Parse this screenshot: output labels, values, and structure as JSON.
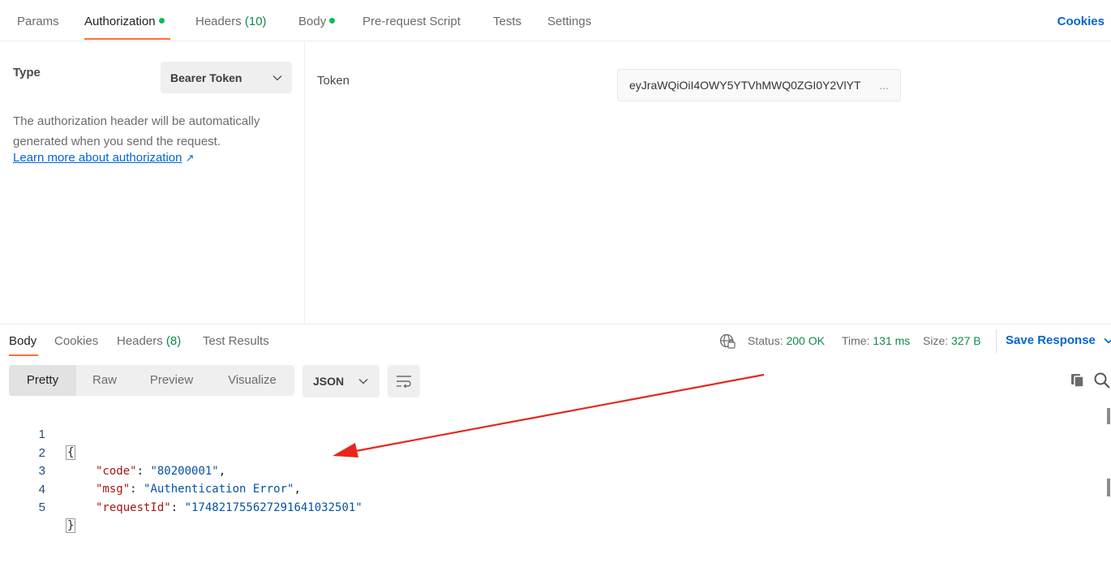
{
  "request_tabs": {
    "params": "Params",
    "authorization": "Authorization",
    "headers": "Headers",
    "headers_count": "(10)",
    "body": "Body",
    "pre_request": "Pre-request Script",
    "tests": "Tests",
    "settings": "Settings",
    "cookies": "Cookies"
  },
  "auth": {
    "type_label": "Type",
    "type_value": "Bearer Token",
    "description": "The authorization header will be automatically generated when you send the request.",
    "learn_more": "Learn more about authorization",
    "learn_more_arrow": "↗",
    "token_label": "Token",
    "token_value": "eyJraWQiOiI4OWY5YTVhMWQ0ZGI0Y2VlYT",
    "token_ellipsis": "..."
  },
  "response": {
    "tabs": {
      "body": "Body",
      "cookies": "Cookies",
      "headers": "Headers",
      "headers_count": "(8)",
      "test_results": "Test Results"
    },
    "status_label": "Status:",
    "status_value": "200 OK",
    "time_label": "Time:",
    "time_value": "131 ms",
    "size_label": "Size:",
    "size_value": "327 B",
    "save_response": "Save Response",
    "view_modes": [
      "Pretty",
      "Raw",
      "Preview",
      "Visualize"
    ],
    "format": "JSON"
  },
  "code": {
    "line_numbers": [
      "1",
      "2",
      "3",
      "4",
      "5"
    ],
    "open_brace": "{",
    "close_brace": "}",
    "fields": [
      {
        "key": "\"code\"",
        "value": "\"80200001\"",
        "comma": ","
      },
      {
        "key": "\"msg\"",
        "value": "\"Authentication Error\"",
        "comma": ","
      },
      {
        "key": "\"requestId\"",
        "value": "\"174821755627291641032501\"",
        "comma": ""
      }
    ]
  },
  "colors": {
    "accent": "#ff6c37",
    "link": "#0265d2",
    "success": "#0f8a4c",
    "annotation_arrow": "#e8261c"
  }
}
